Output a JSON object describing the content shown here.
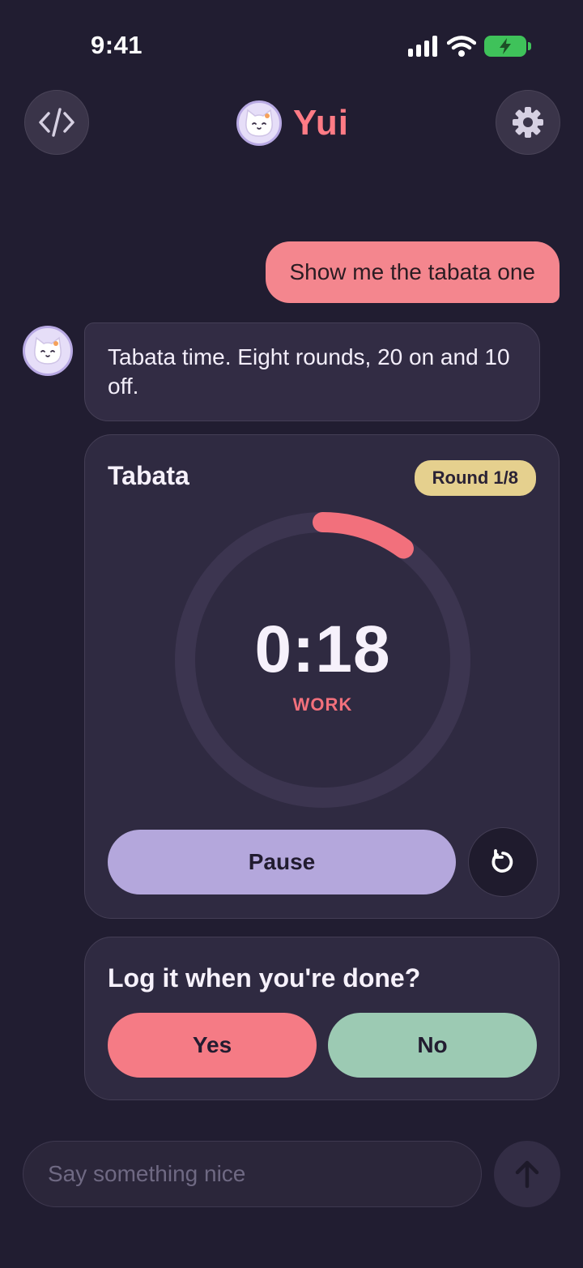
{
  "status_bar": {
    "time": "9:41"
  },
  "header": {
    "brand_name": "Yui",
    "brand_color": "#ff7b85"
  },
  "chat": {
    "user_message": "Show me the tabata one",
    "bot_message": "Tabata time. Eight rounds, 20 on and 10 off."
  },
  "timer_card": {
    "title": "Tabata",
    "round_label": "Round 1/8",
    "time_display": "0:18",
    "phase": "WORK",
    "progress_fraction": 0.1,
    "pause_label": "Pause",
    "accent_color": "#f2707c"
  },
  "log_card": {
    "question": "Log it when you're done?",
    "yes_label": "Yes",
    "no_label": "No"
  },
  "composer": {
    "placeholder": "Say something nice"
  },
  "icons": [
    "code-icon",
    "gear-icon",
    "cat-avatar-icon",
    "reset-icon",
    "arrow-up-icon",
    "signal-icon",
    "wifi-icon",
    "battery-icon"
  ]
}
